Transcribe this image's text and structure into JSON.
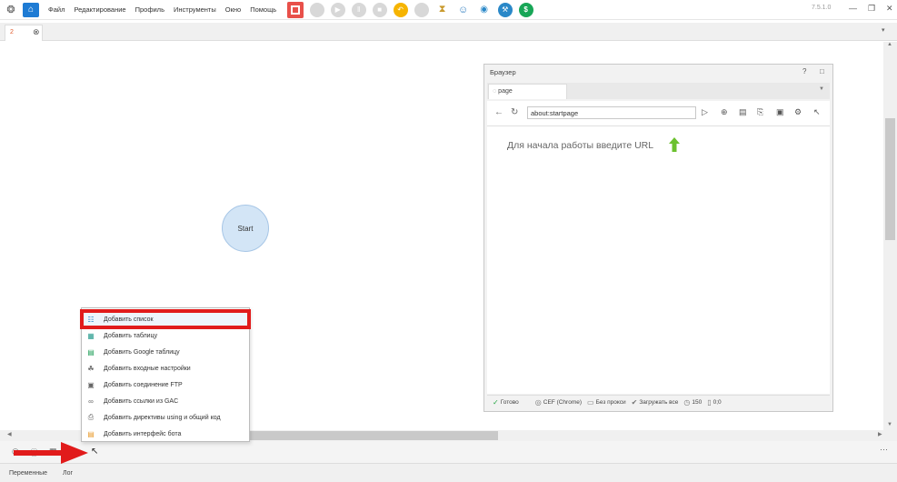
{
  "menubar": {
    "items": [
      "Файл",
      "Редактирование",
      "Профиль",
      "Инструменты",
      "Окно",
      "Помощь"
    ],
    "version": "7.5.1.0",
    "toolbar_icons": [
      "record-icon",
      "circle-icon",
      "play-icon",
      "pause-icon",
      "stop-icon",
      "undo-icon",
      "circle-icon",
      "hourglass-icon",
      "user-icon",
      "eye-icon",
      "recaptcha-icon",
      "dollar-icon"
    ]
  },
  "tabs": {
    "items": [
      {
        "label": "2"
      }
    ]
  },
  "canvas": {
    "start_node": "Start"
  },
  "browser": {
    "title": "Браузер",
    "help": "?",
    "tab_label": "page",
    "url": "about:startpage",
    "hint": "Для начала работы введите URL",
    "status": {
      "ready": "Готово",
      "engine": "CEF (Chrome)",
      "proxy": "Без прокси",
      "load": "Загружать все",
      "zoom": "150",
      "coords": "0;0"
    }
  },
  "context_menu": {
    "items": [
      {
        "label": "Добавить список",
        "icon": "list-icon",
        "highlighted": true
      },
      {
        "label": "Добавить таблицу",
        "icon": "table-icon"
      },
      {
        "label": "Добавить Google таблицу",
        "icon": "google-sheets-icon"
      },
      {
        "label": "Добавить входные настройки",
        "icon": "input-settings-icon"
      },
      {
        "label": "Добавить соединение FTP",
        "icon": "ftp-icon"
      },
      {
        "label": "Добавить ссылки из GAC",
        "icon": "link-icon"
      },
      {
        "label": "Добавить директивы using и общий код",
        "icon": "code-icon"
      },
      {
        "label": "Добавить интерфейс бота",
        "icon": "bot-interface-icon"
      }
    ]
  },
  "bottom_tabs": [
    "Переменные",
    "Лог"
  ],
  "colors": {
    "accent": "#1e7bd4",
    "highlight_border": "#e11b1b",
    "arrow": "#e11b1b",
    "start_node": "#d3e5f6"
  }
}
